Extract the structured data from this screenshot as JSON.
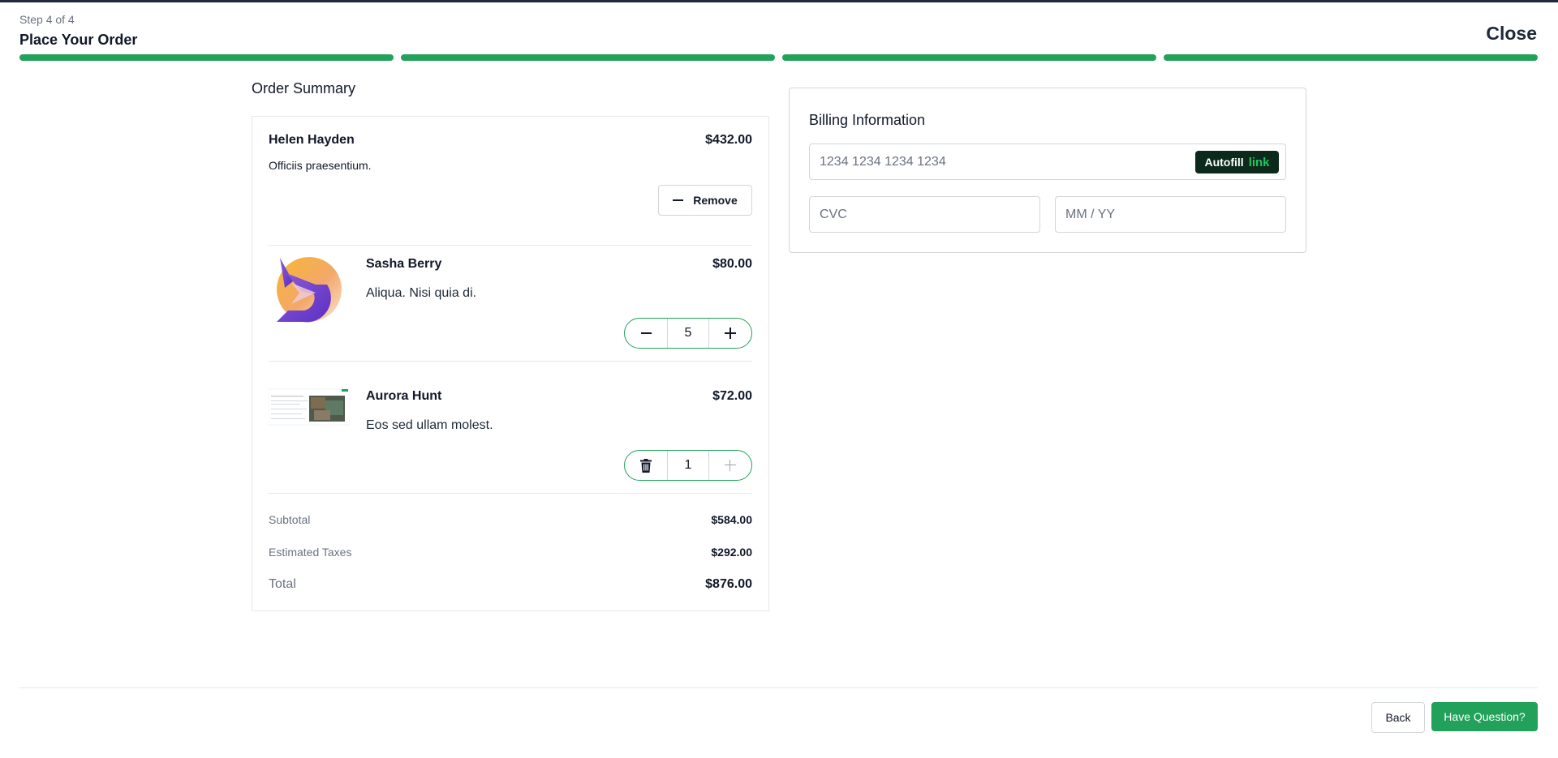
{
  "header": {
    "step": "Step 4 of 4",
    "title": "Place Your Order",
    "close_label": "Close",
    "progress": {
      "total_steps": 4,
      "completed_steps": 4
    }
  },
  "order_summary": {
    "title": "Order Summary",
    "items": [
      {
        "name": "Helen Hayden",
        "price": "$432.00",
        "description": "Officiis praesentium.",
        "action_label": "Remove"
      },
      {
        "name": "Sasha Berry",
        "price": "$80.00",
        "description": "Aliqua. Nisi quia di.",
        "quantity": "5"
      },
      {
        "name": "Aurora Hunt",
        "price": "$72.00",
        "description": "Eos sed ullam molest.",
        "quantity": "1"
      }
    ],
    "subtotal_label": "Subtotal",
    "subtotal_value": "$584.00",
    "taxes_label": "Estimated Taxes",
    "taxes_value": "$292.00",
    "total_label": "Total",
    "total_value": "$876.00"
  },
  "billing": {
    "title": "Billing Information",
    "card_placeholder": "1234 1234 1234 1234",
    "autofill_label": "Autofill",
    "autofill_brand": "link",
    "cvc_placeholder": "CVC",
    "expiry_placeholder": "MM / YY"
  },
  "footer": {
    "back_label": "Back",
    "question_label": "Have Question?"
  },
  "colors": {
    "accent": "#22a15a",
    "autofill_bg": "#0b2a1b"
  }
}
